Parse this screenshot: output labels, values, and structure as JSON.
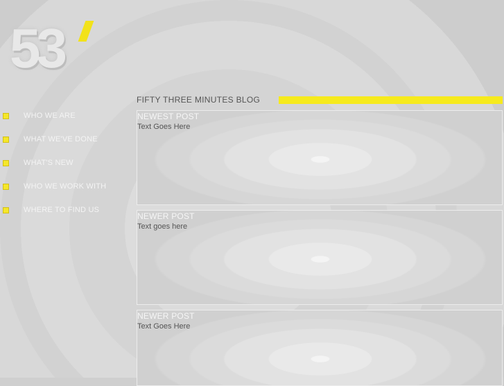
{
  "logo": {
    "text": "53"
  },
  "nav": {
    "items": [
      {
        "label": "WHO WE ARE"
      },
      {
        "label": "WHAT WE'VE DONE"
      },
      {
        "label": "WHAT'S NEW"
      },
      {
        "label": "WHO WE WORK WITH"
      },
      {
        "label": "WHERE TO FIND US"
      }
    ]
  },
  "blog": {
    "title": "FIFTY THREE MINUTES BLOG",
    "posts": [
      {
        "title": "NEWEST POST",
        "body": "Text Goes Here"
      },
      {
        "title": "NEWER POST",
        "body": "Text goes here"
      },
      {
        "title": "NEWER POST",
        "body": "Text Goes Here"
      }
    ]
  },
  "colors": {
    "accent": "#f6ea1d",
    "background": "#cfcfcf",
    "nav_text": "#f4f4f4"
  }
}
